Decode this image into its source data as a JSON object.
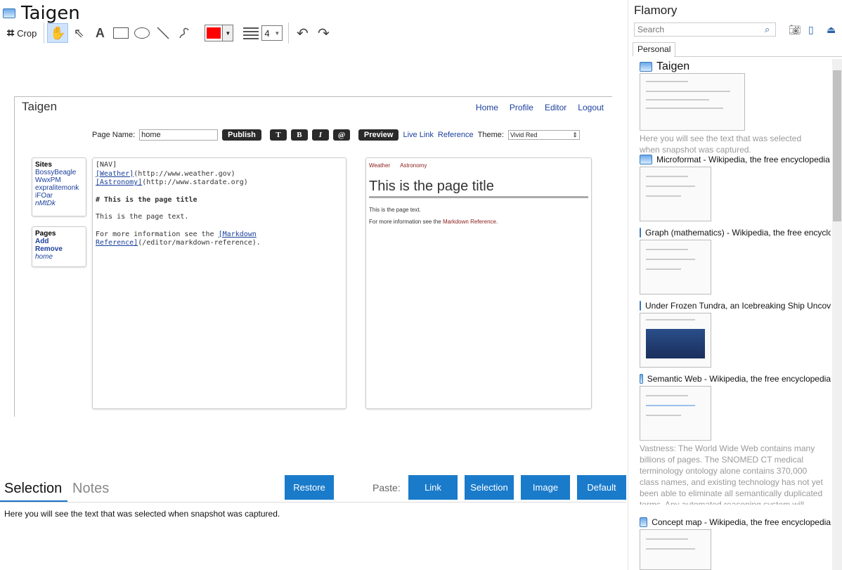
{
  "window": {
    "title": "Taigen"
  },
  "toolbar": {
    "crop_label": "Crop",
    "line_width": "4",
    "selected_color": "#ff0000"
  },
  "snapshot": {
    "title": "Taigen",
    "nav": [
      "Home",
      "Profile",
      "Editor",
      "Logout"
    ],
    "page_name_label": "Page Name:",
    "page_name_value": "home",
    "publish": "Publish",
    "fmt_buttons": [
      "T",
      "B",
      "I",
      "@"
    ],
    "preview": "Preview",
    "live_link": "Live Link",
    "reference": "Reference",
    "theme_label": "Theme:",
    "theme_value": "Vivid Red",
    "sites_heading": "Sites",
    "sites": [
      "BossyBeagle",
      "WwxPM",
      "expralitemonk",
      "iFOar",
      "nMtDk"
    ],
    "pages_heading": "Pages",
    "pages_add": "Add",
    "pages_remove": "Remove",
    "pages_home": "home",
    "editor_lines": {
      "l1": "[NAV]",
      "l2a": "[Weather]",
      "l2b": "(http://www.weather.gov)",
      "l3a": "[Astronomy]",
      "l3b": "(http://www.stardate.org)",
      "l4": "# This is the page title",
      "l5": "This is the page text.",
      "l6a": "For more information see the ",
      "l6b": "[Markdown",
      "l7a": "Reference]",
      "l7b": "(/editor/markdown-reference)."
    },
    "preview_nav": [
      "Weather",
      "Astronomy"
    ],
    "preview_title": "This is the page title",
    "preview_text": "This is the page text.",
    "preview_more": "For more information see the ",
    "preview_more_link": "Markdown Reference",
    "preview_more_end": "."
  },
  "bottom": {
    "tab_selection": "Selection",
    "tab_notes": "Notes",
    "restore": "Restore",
    "paste_label": "Paste:",
    "paste_buttons": [
      "Link",
      "Selection",
      "Image",
      "Default"
    ],
    "selection_text": "Here you will see the text that was selected when snapshot was captured."
  },
  "sidebar": {
    "title": "Flamory",
    "search_placeholder": "Search",
    "tab": "Personal",
    "items": [
      {
        "title": "Taigen",
        "desc": "Here you will see the text that was selected when snapshot was captured."
      },
      {
        "title": "Microformat - Wikipedia, the free encyclopedia"
      },
      {
        "title": "Graph (mathematics) - Wikipedia, the free encyclopedia"
      },
      {
        "title": "Under Frozen Tundra, an Icebreaking Ship Uncovers..."
      },
      {
        "title": "Semantic Web - Wikipedia, the free encyclopedia",
        "desc": "Vastness: The World Wide Web contains many billions of pages. The SNOMED CT medical terminology ontology alone contains 370,000 class names, and existing technology has not yet been able to eliminate all semantically duplicated terms. Any automated reasoning system will have to deal with truly huge inputs."
      },
      {
        "title": "Concept map - Wikipedia, the free encyclopedia"
      }
    ]
  }
}
